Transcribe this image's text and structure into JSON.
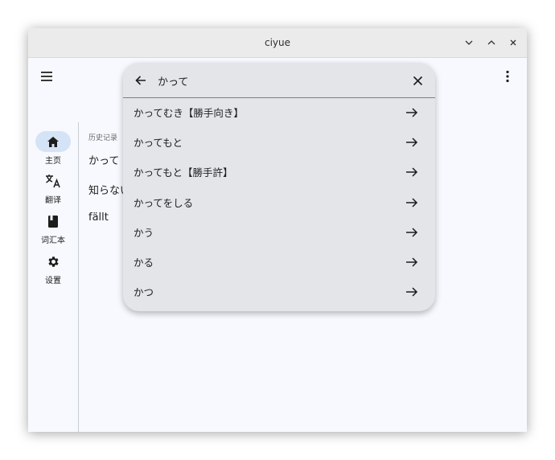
{
  "window": {
    "title": "ciyue"
  },
  "rail": {
    "items": [
      {
        "label": "主页",
        "icon": "home-icon",
        "active": true
      },
      {
        "label": "翻译",
        "icon": "translate-icon",
        "active": false
      },
      {
        "label": "词汇本",
        "icon": "book-icon",
        "active": false
      },
      {
        "label": "设置",
        "icon": "gear-icon",
        "active": false
      }
    ]
  },
  "history": {
    "heading": "历史记录",
    "items": [
      "かって",
      "知らない",
      "fällt"
    ]
  },
  "search": {
    "value": "かって",
    "suggestions": [
      "かってむき【勝手向き】",
      "かってもと",
      "かってもと【勝手許】",
      "かってをしる",
      "かう",
      "かる",
      "かつ"
    ]
  },
  "colors": {
    "background": "#f7f9fe",
    "popup": "#e3e5e9",
    "rail_active": "#d5e3f6",
    "titlebar": "#ebebeb"
  }
}
